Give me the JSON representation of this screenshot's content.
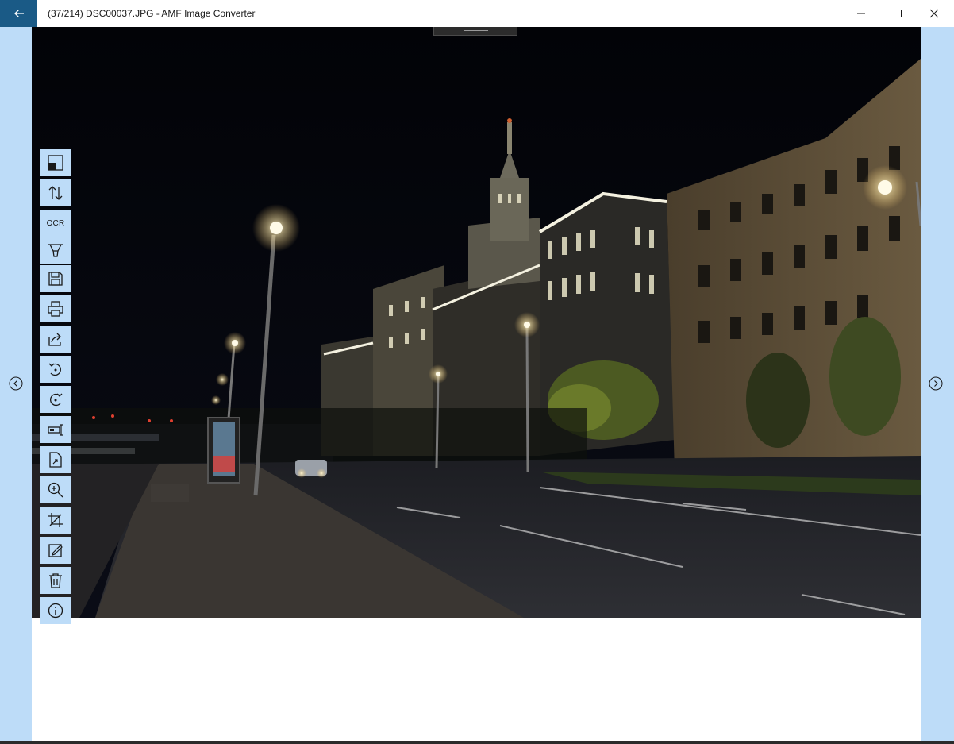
{
  "window": {
    "title": "(37/214) DSC00037.JPG - AMF Image Converter",
    "back_icon": "arrow-left-icon",
    "minimize_icon": "minimize-icon",
    "maximize_icon": "maximize-icon",
    "close_icon": "close-icon"
  },
  "navigation": {
    "prev_icon": "chevron-left-circle-icon",
    "next_icon": "chevron-right-circle-icon"
  },
  "toolbar": {
    "ocr_label": "OCR",
    "tools": [
      {
        "id": "contrast",
        "icon": "contrast-icon"
      },
      {
        "id": "sort",
        "icon": "sort-arrows-icon"
      },
      {
        "id": "ocr",
        "icon": "ocr-text"
      },
      {
        "id": "funnel",
        "icon": "funnel-icon"
      },
      {
        "id": "save",
        "icon": "save-icon"
      },
      {
        "id": "print",
        "icon": "print-icon"
      },
      {
        "id": "share",
        "icon": "share-icon"
      },
      {
        "id": "rotate-left",
        "icon": "rotate-left-icon"
      },
      {
        "id": "rotate-right",
        "icon": "rotate-right-icon"
      },
      {
        "id": "resize",
        "icon": "resize-icon"
      },
      {
        "id": "export",
        "icon": "export-file-icon"
      },
      {
        "id": "zoom",
        "icon": "zoom-in-icon"
      },
      {
        "id": "crop",
        "icon": "crop-icon"
      },
      {
        "id": "edit",
        "icon": "edit-icon"
      },
      {
        "id": "delete",
        "icon": "delete-icon"
      },
      {
        "id": "info",
        "icon": "info-icon"
      }
    ]
  },
  "colors": {
    "accent": "#1a5a86",
    "panel": "#bddcf8",
    "photo_background": "#05060b"
  }
}
